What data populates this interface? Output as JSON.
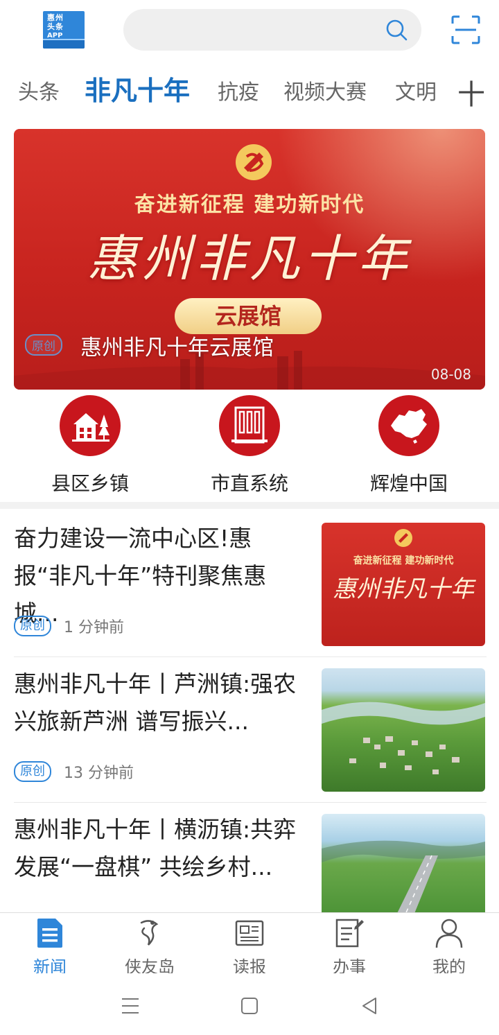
{
  "header": {
    "logo_lines": [
      "惠州",
      "头条",
      "APP"
    ],
    "search_placeholder": ""
  },
  "tabs": [
    {
      "label": "头条",
      "active": false
    },
    {
      "label": "非凡十年",
      "active": true
    },
    {
      "label": "抗疫",
      "active": false
    },
    {
      "label": "视频大赛",
      "active": false
    },
    {
      "label": "文明",
      "active": false
    }
  ],
  "tabs_more": "十",
  "banner": {
    "slogan": "奋进新征程  建功新时代",
    "calligraphy": "惠州非凡十年",
    "pill": "云展馆",
    "tag": "原创",
    "title": "惠州非凡十年云展馆",
    "date": "08-08"
  },
  "quick_links": [
    {
      "label": "县区乡镇",
      "icon": "house-tree-icon"
    },
    {
      "label": "市直系统",
      "icon": "building-icon"
    },
    {
      "label": "辉煌中国",
      "icon": "china-map-icon"
    }
  ],
  "news": [
    {
      "title": "奋力建设一流中心区!惠报“非凡十年”特刊聚焦惠城...",
      "tag": "原创",
      "time": "1 分钟前",
      "thumb_slogan": "奋进新征程  建功新时代",
      "thumb_calligraphy": "惠州非凡十年"
    },
    {
      "title": "惠州非凡十年丨芦洲镇:强农兴旅新芦洲 谱写振兴...",
      "tag": "原创",
      "time": "13 分钟前"
    },
    {
      "title": "惠州非凡十年丨横沥镇:共弈发展“一盘棋” 共绘乡村..."
    }
  ],
  "bottom_nav": [
    {
      "label": "新闻",
      "icon": "news-doc-icon",
      "active": true
    },
    {
      "label": "侠友岛",
      "icon": "hero-icon",
      "active": false
    },
    {
      "label": "读报",
      "icon": "newspaper-icon",
      "active": false
    },
    {
      "label": "办事",
      "icon": "edit-doc-icon",
      "active": false
    },
    {
      "label": "我的",
      "icon": "person-icon",
      "active": false
    }
  ],
  "colors": {
    "accent": "#2f86d9",
    "tab_active": "#1a6fbf",
    "brand_red": "#c8161d"
  }
}
